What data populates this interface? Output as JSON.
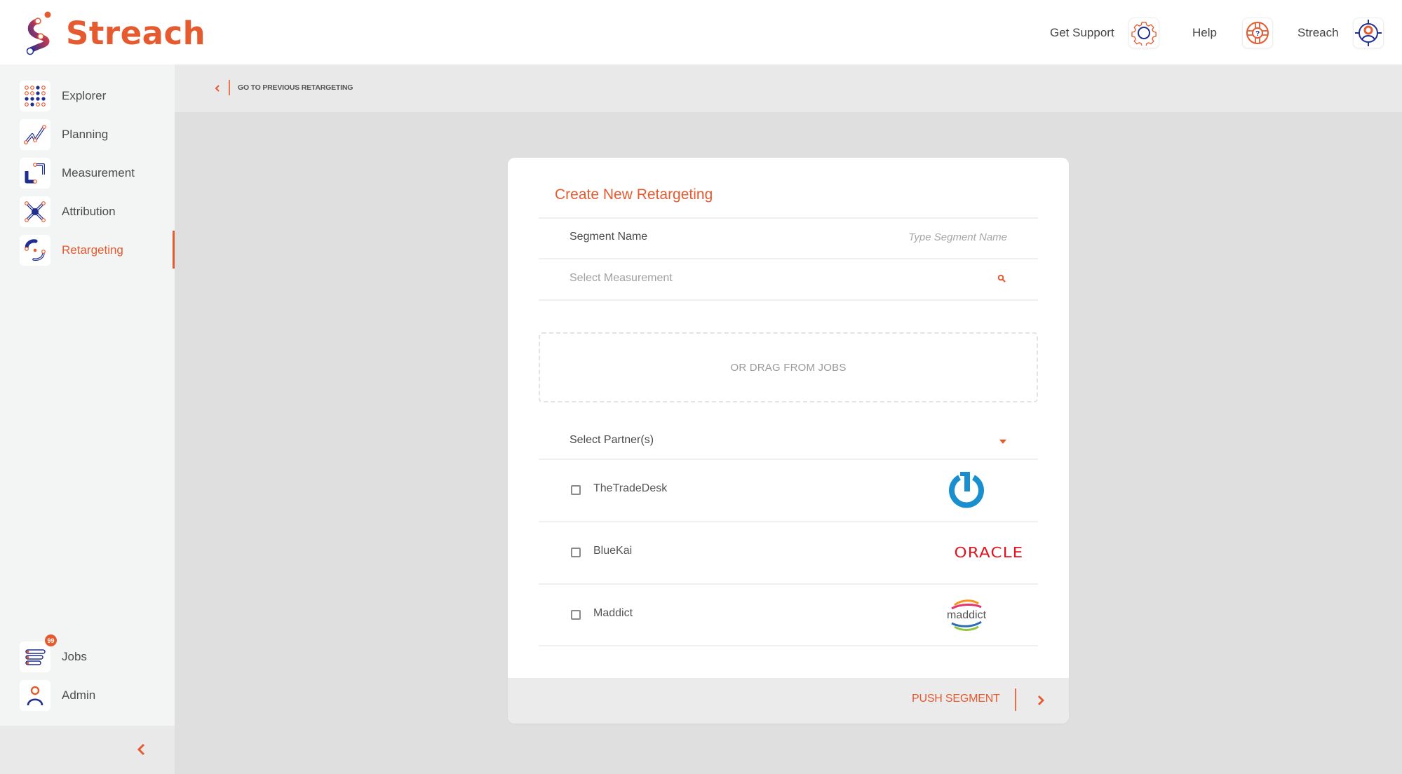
{
  "app": {
    "brand_name": "Streach",
    "colors": {
      "accent": "#e65a2f",
      "navy": "#1f2f8f",
      "sidebar_bg": "#f3f4f4",
      "content_bg": "#dfdfdf"
    }
  },
  "header": {
    "links": [
      {
        "label": "Get Support",
        "icon": "gear-icon"
      },
      {
        "label": "Help",
        "icon": "lifebuoy-help-icon"
      },
      {
        "label": "Streach",
        "icon": "user-target-icon"
      }
    ]
  },
  "sidebar": {
    "items": [
      {
        "label": "Explorer",
        "icon": "explorer-dots-icon",
        "active": false
      },
      {
        "label": "Planning",
        "icon": "planning-chart-icon",
        "active": false
      },
      {
        "label": "Measurement",
        "icon": "measurement-corners-icon",
        "active": false
      },
      {
        "label": "Attribution",
        "icon": "attribution-cross-icon",
        "active": false
      },
      {
        "label": "Retargeting",
        "icon": "retargeting-arcs-icon",
        "active": true
      }
    ],
    "bottom_items": [
      {
        "label": "Jobs",
        "icon": "jobs-list-icon",
        "badge": "99"
      },
      {
        "label": "Admin",
        "icon": "admin-user-icon"
      }
    ],
    "collapse_icon": "chevron-left-icon"
  },
  "breadcrumb": {
    "back_label": "GO TO PREVIOUS RETARGETING"
  },
  "form": {
    "title": "Create New Retargeting",
    "segment_name": {
      "label": "Segment Name",
      "placeholder": "Type Segment Name",
      "value": ""
    },
    "measurement": {
      "placeholder": "Select Measurement",
      "value": ""
    },
    "dropzone_text": "OR DRAG FROM JOBS",
    "partner_select": {
      "label": "Select Partner(s)"
    },
    "partners": [
      {
        "name": "TheTradeDesk",
        "checked": false,
        "logo": "thetradedesk-logo"
      },
      {
        "name": "BlueKai",
        "checked": false,
        "logo": "oracle-logo",
        "logo_text": "ORACLE"
      },
      {
        "name": "Maddict",
        "checked": false,
        "logo": "maddict-logo",
        "logo_text": "maddict"
      }
    ],
    "footer": {
      "push_label": "PUSH SEGMENT"
    }
  }
}
